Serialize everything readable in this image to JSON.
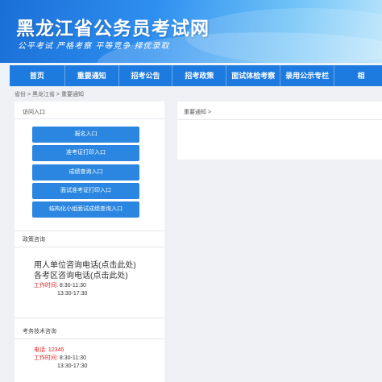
{
  "site": {
    "title": "黑龙江省公务员考试网",
    "slogan": "公平考试 严格考察 平等竞争 择优录取"
  },
  "nav": [
    "首页",
    "重要通知",
    "招考公告",
    "招考政策",
    "面试体检考察",
    "录用公示专栏",
    "相"
  ],
  "breadcrumb": "省份 > 黑龙江省 > 重要通知",
  "sidebar": {
    "entry_title": "访问入口",
    "buttons": [
      "报名入口",
      "准考证打印入口",
      "成绩查询入口",
      "面试准考证打印入口",
      "结构化小组面试成绩查询入口"
    ],
    "policy_title": "政策咨询",
    "policy_lines": [
      "用人单位咨询电话(点击此处)",
      "各考区咨询电话(点击此处)"
    ],
    "work_time_label": "工作时间:",
    "work_time_1": "8:30-11:30",
    "work_time_2": "13:30-17:30",
    "tech_title": "考务技术咨询",
    "tech_phone": "电话: 12345",
    "tech_time_1": "8:30-11:30",
    "tech_time_2": "13:30-17:30"
  },
  "main": {
    "header": "重要通知 >"
  },
  "colors": {
    "nav_bg": "#1d7be0",
    "button_bg": "#2a86e0",
    "accent_red": "#dd2222"
  }
}
